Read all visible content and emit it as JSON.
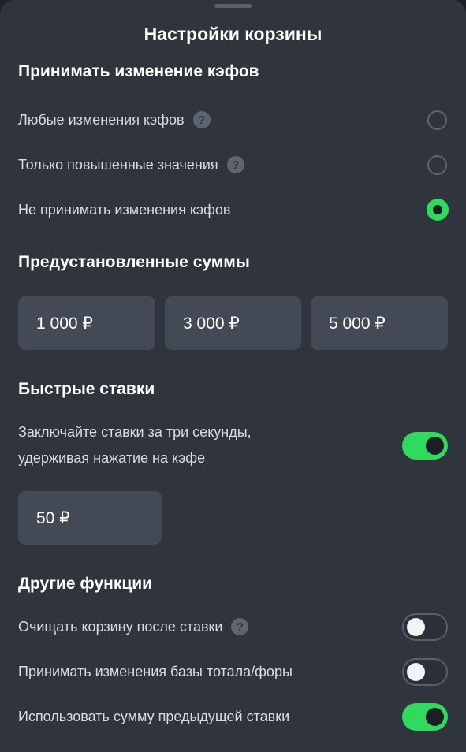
{
  "sheet": {
    "title": "Настройки корзины"
  },
  "odds_changes": {
    "title": "Принимать изменение кэфов",
    "options": [
      {
        "label": "Любые изменения кэфов",
        "has_help": true,
        "selected": false
      },
      {
        "label": "Только повышенные значения",
        "has_help": true,
        "selected": false
      },
      {
        "label": "Не принимать изменения кэфов",
        "has_help": false,
        "selected": true
      }
    ]
  },
  "preset_amounts": {
    "title": "Предустановленные суммы",
    "amounts": [
      "1 000 ₽",
      "3 000 ₽",
      "5 000 ₽"
    ]
  },
  "quick_bets": {
    "title": "Быстрые ставки",
    "line1": "Заключайте ставки за три секунды,",
    "line2": "удерживая нажатие на кэфе",
    "enabled": true,
    "amount": "50 ₽"
  },
  "other": {
    "title": "Другие функции",
    "items": [
      {
        "label": "Очищать корзину после ставки",
        "has_help": true,
        "enabled": false
      },
      {
        "label": "Принимать изменения базы тотала/форы",
        "has_help": false,
        "enabled": false
      },
      {
        "label": "Использовать сумму предыдущей ставки",
        "has_help": false,
        "enabled": true
      }
    ]
  },
  "icons": {
    "help": "question-mark-icon",
    "help_glyph": "?"
  },
  "colors": {
    "accent": "#2edb5c",
    "background": "#30343d",
    "chip": "#444a55"
  }
}
